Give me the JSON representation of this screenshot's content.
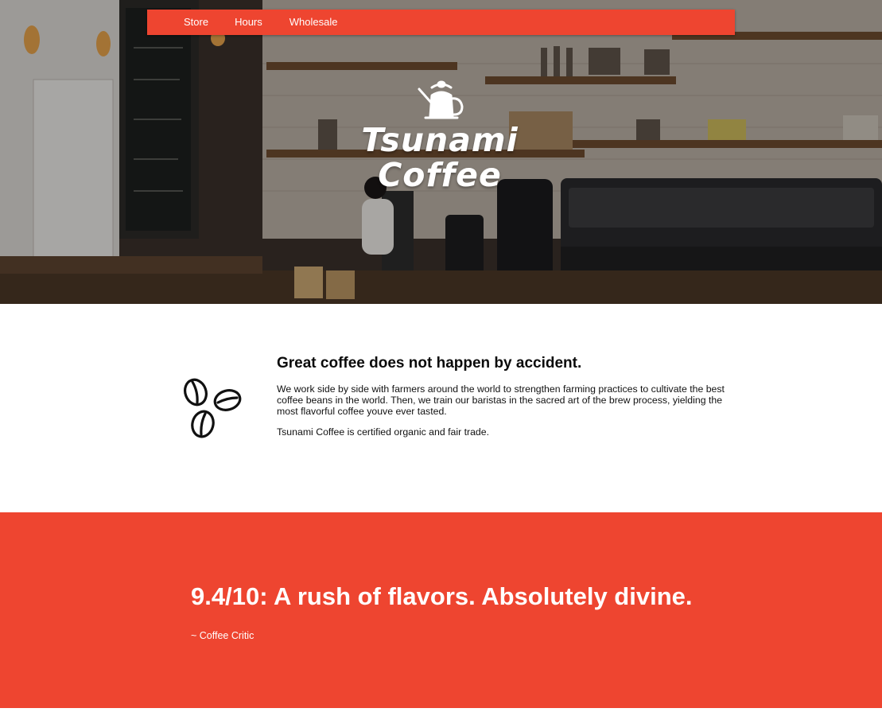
{
  "nav": {
    "items": [
      {
        "label": "Store"
      },
      {
        "label": "Hours"
      },
      {
        "label": "Wholesale"
      }
    ],
    "background": "#ee4530"
  },
  "hero": {
    "logo_line_1": "Tsunami",
    "logo_line_2": "Coffee",
    "logo_icon": "kettle-icon"
  },
  "about": {
    "icon": "coffee-beans-icon",
    "heading": "Great coffee does not happen by accident.",
    "paragraph_1": "We work side by side with farmers around the world to strengthen farming practices to cultivate the best coffee beans in the world. Then, we train our baristas in the sacred art of the brew process, yielding the most flavorful coffee youve ever tasted.",
    "paragraph_2": "Tsunami Coffee is certified organic and fair trade."
  },
  "review": {
    "quote": "9.4/10: A rush of flavors. Absolutely divine.",
    "attribution": "~ Coffee Critic",
    "background": "#ee4530"
  }
}
